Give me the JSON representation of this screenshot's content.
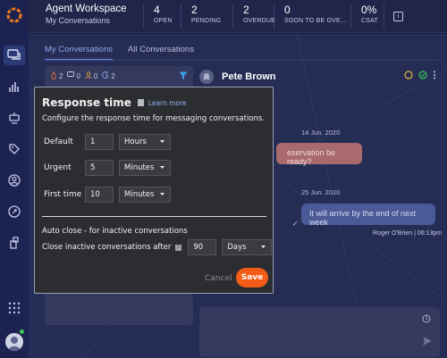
{
  "header": {
    "workspace_title": "Agent Workspace",
    "workspace_sub": "My Conversations",
    "stats": [
      {
        "value": "4",
        "label": "OPEN"
      },
      {
        "value": "2",
        "label": "PENDING"
      },
      {
        "value": "2",
        "label": "OVERDUE"
      },
      {
        "value": "0",
        "label": "SOON TO BE OVE..."
      },
      {
        "value": "0%",
        "label": "CSAT"
      }
    ]
  },
  "sidebar": {
    "icons": [
      "chat-icon",
      "bar-chart-icon",
      "robot-icon",
      "tag-icon",
      "user-icon",
      "rocket-icon",
      "building-icon"
    ]
  },
  "tabs": [
    {
      "label": "My Conversations",
      "active": true
    },
    {
      "label": "All Conversations",
      "active": false
    }
  ],
  "filters": [
    {
      "icon": "flame-icon",
      "count": "2"
    },
    {
      "icon": "speech-icon",
      "count": "0"
    },
    {
      "icon": "person-icon",
      "count": "0"
    },
    {
      "icon": "moon-icon",
      "count": "2"
    }
  ],
  "conversation": {
    "contact_name": "Pete Brown",
    "date_1": "14 Jun. 2020",
    "incoming_msg": "eservation be ready?",
    "date_2": "25 Jun. 2020",
    "outgoing_msg": "It will arrive by the end of next week",
    "msg_meta": "Roger O'Brien  |  06:13pm"
  },
  "modal": {
    "title": "Response time",
    "learn_more": "Learn more",
    "description": "Configure the response time for messaging conversations.",
    "rows": [
      {
        "label": "Default",
        "value": "1",
        "unit": "Hours"
      },
      {
        "label": "Urgent",
        "value": "5",
        "unit": "Minutes"
      },
      {
        "label": "First time",
        "value": "10",
        "unit": "Minutes"
      }
    ],
    "auto_close_title": "Auto close - for inactive conversations",
    "close_label": "Close inactive conversations after",
    "close_value": "90",
    "close_unit": "Days",
    "cancel_label": "Cancel",
    "save_label": "Save",
    "accent": "#f45b16"
  },
  "colors": {
    "rail": "#1c2350",
    "background": "#262d55",
    "modal_bg": "#2c2d30"
  }
}
